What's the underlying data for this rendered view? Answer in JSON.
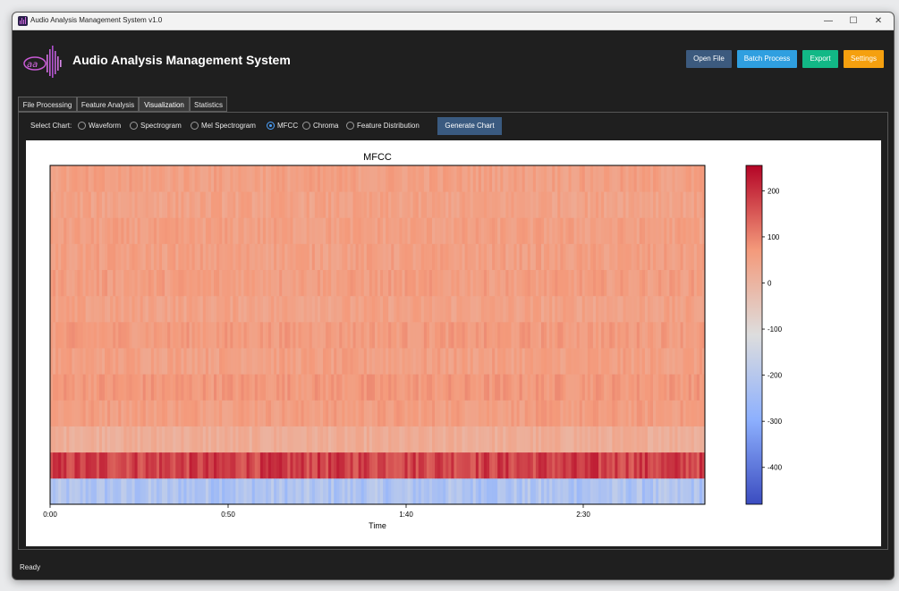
{
  "window": {
    "title": "Audio Analysis Management System v1.0",
    "controls": {
      "minimize": "—",
      "maximize": "☐",
      "close": "✕"
    }
  },
  "header": {
    "title": "Audio Analysis Management System",
    "logo_icon": "audio-waveform-logo",
    "buttons": {
      "open_file": "Open File",
      "batch_process": "Batch Process",
      "export": "Export",
      "settings": "Settings"
    },
    "button_colors": {
      "open_file": "#3c5a7e",
      "batch_process": "#2f9fe0",
      "export": "#12b886",
      "settings": "#f5a00f"
    }
  },
  "tabs": [
    "File Processing",
    "Feature Analysis",
    "Visualization",
    "Statistics"
  ],
  "active_tab": "Visualization",
  "chart_selector": {
    "label": "Select Chart:",
    "options": [
      "Waveform",
      "Spectrogram",
      "Mel Spectrogram",
      "MFCC",
      "Chroma",
      "Feature Distribution"
    ],
    "selected": "MFCC",
    "generate_button": "Generate Chart"
  },
  "chart_data": {
    "type": "heatmap",
    "title": "MFCC",
    "xlabel": "Time",
    "ylabel": "",
    "x_ticks": [
      "0:00",
      "0:50",
      "1:40",
      "2:30"
    ],
    "colorbar": {
      "colormap": "coolwarm",
      "ticks": [
        200,
        100,
        0,
        -100,
        -200,
        -300,
        -400
      ],
      "range": [
        -480,
        255
      ]
    },
    "rows": [
      {
        "coefficient": 1,
        "mean_value": -220
      },
      {
        "coefficient": 2,
        "mean_value": 180
      },
      {
        "coefficient": 3,
        "mean_value": 20
      },
      {
        "coefficient": 4,
        "mean_value": 60
      },
      {
        "coefficient": 5,
        "mean_value": 70
      },
      {
        "coefficient": 6,
        "mean_value": 55
      },
      {
        "coefficient": 7,
        "mean_value": 65
      },
      {
        "coefficient": 8,
        "mean_value": 50
      },
      {
        "coefficient": 9,
        "mean_value": 60
      },
      {
        "coefficient": 10,
        "mean_value": 55
      },
      {
        "coefficient": 11,
        "mean_value": 55
      },
      {
        "coefficient": 12,
        "mean_value": 50
      },
      {
        "coefficient": 13,
        "mean_value": 55
      }
    ]
  },
  "status": "Ready"
}
